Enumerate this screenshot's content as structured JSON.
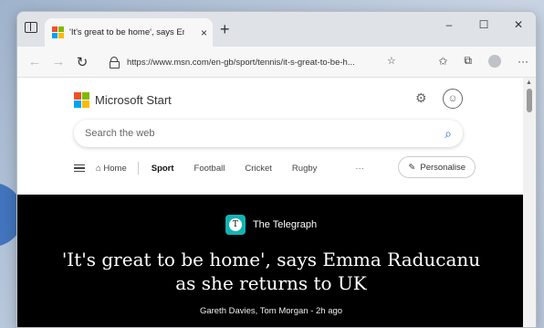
{
  "browser": {
    "tab": {
      "title": "'It's great to be home', says Emm",
      "close_label": "×"
    },
    "new_tab_label": "+",
    "window_controls": {
      "minimize": "–",
      "maximize": "☐",
      "close": "✕"
    },
    "nav": {
      "back": "←",
      "forward": "→",
      "refresh": "↻"
    },
    "url": "https://www.msn.com/en-gb/sport/tennis/it-s-great-to-be-h...",
    "toolbar_icons": {
      "favorite_add": "☆",
      "favorites": "✩",
      "collections": "⧉",
      "more": "···"
    }
  },
  "page": {
    "brand_name": "Microsoft Start",
    "search_placeholder": "Search the web",
    "nav_items": {
      "home": "Home",
      "sport": "Sport",
      "football": "Football",
      "cricket": "Cricket",
      "rugby": "Rugby",
      "more": "···",
      "personalise": "Personalise"
    },
    "article": {
      "publisher": "The Telegraph",
      "headline_line1": "'It's great to be home', says Emma Raducanu",
      "headline_line2": "as she returns to UK",
      "byline": "Gareth Davies, Tom Morgan - 2h ago"
    }
  },
  "colors": {
    "ms_red": "#f25022",
    "ms_green": "#7fba00",
    "ms_blue": "#00a4ef",
    "ms_yellow": "#ffb900",
    "article_bg": "#000000",
    "telegraph_teal": "#14b3b3",
    "accent_blue": "#1b6ec2"
  }
}
